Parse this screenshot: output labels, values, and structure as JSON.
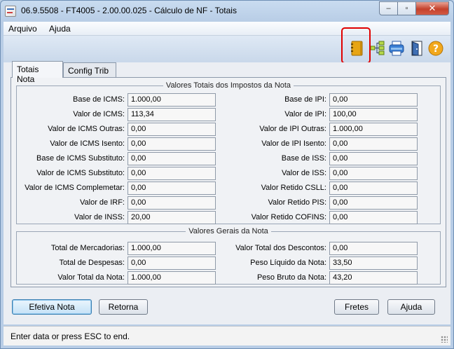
{
  "window": {
    "title": "06.9.5508 - FT4005 - 2.00.00.025 - Cálculo de NF - Totais",
    "controls": {
      "minimize": "–",
      "maximize": "▫",
      "close": "✕"
    }
  },
  "menu": {
    "items": [
      "Arquivo",
      "Ajuda"
    ]
  },
  "toolbar": {
    "icons": [
      "notebook-icon",
      "tree-structure-icon",
      "printer-icon",
      "exit-door-icon",
      "help-icon"
    ],
    "highlight_color": "#e00000"
  },
  "tabs": [
    {
      "label": "Totais Nota",
      "active": true
    },
    {
      "label": "Config Trib",
      "active": false
    }
  ],
  "impostos": {
    "legend": "Valores Totais dos Impostos da Nota",
    "left": [
      {
        "label": "Base de ICMS:",
        "value": "1.000,00"
      },
      {
        "label": "Valor de ICMS:",
        "value": "113,34"
      },
      {
        "label": "Valor de ICMS Outras:",
        "value": "0,00"
      },
      {
        "label": "Valor de ICMS Isento:",
        "value": "0,00"
      },
      {
        "label": "Base de ICMS Substituto:",
        "value": "0,00"
      },
      {
        "label": "Valor de ICMS Substituto:",
        "value": "0,00"
      },
      {
        "label": "Valor de ICMS Complemetar:",
        "value": "0,00"
      },
      {
        "label": "Valor de IRF:",
        "value": "0,00"
      },
      {
        "label": "Valor de INSS:",
        "value": "20,00"
      }
    ],
    "right": [
      {
        "label": "Base de IPI:",
        "value": "0,00"
      },
      {
        "label": "Valor de IPI:",
        "value": "100,00"
      },
      {
        "label": "Valor de IPI Outras:",
        "value": "1.000,00"
      },
      {
        "label": "Valor de IPI Isento:",
        "value": "0,00"
      },
      {
        "label": "Base de ISS:",
        "value": "0,00"
      },
      {
        "label": "Valor de ISS:",
        "value": "0,00"
      },
      {
        "label": "Valor Retido CSLL:",
        "value": "0,00"
      },
      {
        "label": "Valor Retido PIS:",
        "value": "0,00"
      },
      {
        "label": "Valor Retido COFINS:",
        "value": "0,00"
      }
    ]
  },
  "gerais": {
    "legend": "Valores Gerais da Nota",
    "left": [
      {
        "label": "Total de Mercadorias:",
        "value": "1.000,00"
      },
      {
        "label": "Total de Despesas:",
        "value": "0,00"
      },
      {
        "label": "Valor Total da Nota:",
        "value": "1.000,00"
      }
    ],
    "right": [
      {
        "label": "Valor Total dos Descontos:",
        "value": "0,00"
      },
      {
        "label": "Peso Líquido da Nota:",
        "value": "33,50"
      },
      {
        "label": "Peso Bruto da Nota:",
        "value": "43,20"
      }
    ]
  },
  "buttons": {
    "efetiva": "Efetiva Nota",
    "retorna": "Retorna",
    "fretes": "Fretes",
    "ajuda": "Ajuda"
  },
  "status": {
    "text": "Enter data or press ESC to end."
  }
}
